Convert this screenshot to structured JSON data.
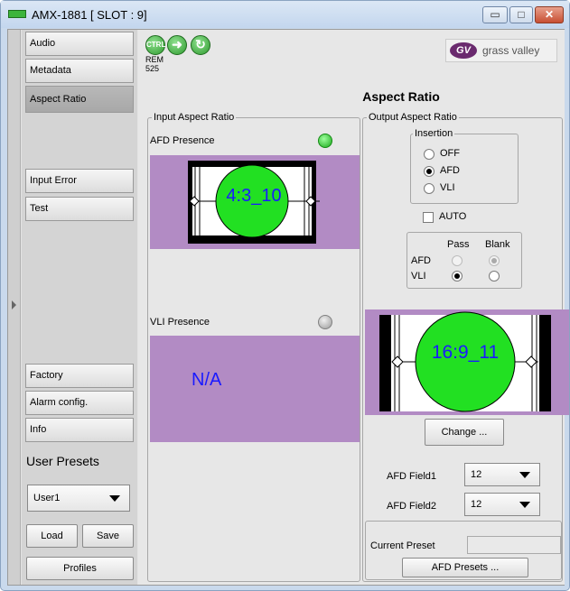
{
  "window": {
    "title": "AMX-1881 [ SLOT : 9]",
    "minimize": "▭",
    "maximize": "□",
    "close": "✕"
  },
  "sidebar": {
    "items": [
      {
        "label": "Audio"
      },
      {
        "label": "Metadata"
      },
      {
        "label": "Aspect Ratio",
        "active": true
      },
      {
        "label": "Input Error"
      },
      {
        "label": "Test"
      },
      {
        "label": "Factory"
      },
      {
        "label": "Alarm config."
      },
      {
        "label": "Info"
      }
    ],
    "user_presets_label": "User Presets",
    "preset_selected": "User1",
    "load_label": "Load",
    "save_label": "Save",
    "profiles_label": "Profiles"
  },
  "header": {
    "icons": [
      "ctrl-icon",
      "arrow-icon",
      "refresh-icon"
    ],
    "ctrl_text": "CTRL",
    "rem_text": "REM 525",
    "logo_mark": "GV",
    "logo_text": "grass valley"
  },
  "main": {
    "heading": "Aspect Ratio",
    "input": {
      "group_label": "Input Aspect Ratio",
      "afd_presence_label": "AFD Presence",
      "afd_presence_status": "on",
      "afd_code": "4:3_10",
      "vli_presence_label": "VLI Presence",
      "vli_presence_status": "off",
      "vli_value": "N/A"
    },
    "output": {
      "group_label": "Output Aspect Ratio",
      "insertion_label": "Insertion",
      "insertion_options": [
        "OFF",
        "AFD",
        "VLI"
      ],
      "insertion_selected": "AFD",
      "auto_label": "AUTO",
      "auto_checked": false,
      "pass_label": "Pass",
      "blank_label": "Blank",
      "afd_row_label": "AFD",
      "vli_row_label": "VLI",
      "afd_selected": "Blank",
      "vli_selected": "Pass",
      "afd_code": "16:9_11",
      "change_label": "Change ...",
      "afd_field1_label": "AFD Field1",
      "afd_field1_value": "12",
      "afd_field2_label": "AFD Field2",
      "afd_field2_value": "12",
      "current_preset_label": "Current Preset",
      "current_preset_value": "",
      "afd_presets_label": "AFD Presets ..."
    }
  },
  "colors": {
    "preview_bg": "#b28bc4",
    "led_on": "#1aa81a",
    "circle": "#22e022",
    "code_text": "#1a1aff"
  }
}
